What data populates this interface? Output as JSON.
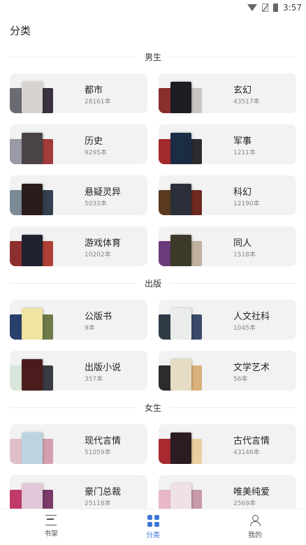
{
  "status_bar": {
    "time": "3:57",
    "icons": [
      "wifi-icon",
      "no-sim-icon",
      "battery-icon"
    ]
  },
  "page": {
    "title": "分类"
  },
  "sections": [
    {
      "label": "男生",
      "items": [
        {
          "name": "都市",
          "count": "28161本",
          "cover_colors": [
            "#6b6b74",
            "#d8d3ce",
            "#3a3240"
          ]
        },
        {
          "name": "玄幻",
          "count": "43517本",
          "cover_colors": [
            "#8a2e2e",
            "#1f1b22",
            "#c9c4c2"
          ]
        },
        {
          "name": "历史",
          "count": "9295本",
          "cover_colors": [
            "#9a9aa4",
            "#4a4448",
            "#a23b3b"
          ]
        },
        {
          "name": "军事",
          "count": "1211本",
          "cover_colors": [
            "#a32a2a",
            "#1b2c45",
            "#2c2b30"
          ]
        },
        {
          "name": "悬疑灵异",
          "count": "5033本",
          "cover_colors": [
            "#7c8a96",
            "#2a1c1c",
            "#344050"
          ]
        },
        {
          "name": "科幻",
          "count": "12190本",
          "cover_colors": [
            "#5a3a20",
            "#2b2f3a",
            "#6e2a20"
          ]
        },
        {
          "name": "游戏体育",
          "count": "10202本",
          "cover_colors": [
            "#8c2e2e",
            "#1e2230",
            "#b04036"
          ]
        },
        {
          "name": "同人",
          "count": "1518本",
          "cover_colors": [
            "#6a3a7a",
            "#3d3a2a",
            "#c0b0a0"
          ]
        }
      ]
    },
    {
      "label": "出版",
      "items": [
        {
          "name": "公版书",
          "count": "9本",
          "cover_colors": [
            "#2a3f6a",
            "#efe4a0",
            "#6f7a4a"
          ]
        },
        {
          "name": "人文社科",
          "count": "1045本",
          "cover_colors": [
            "#2f3c48",
            "#e9ecea",
            "#3b4a6a"
          ]
        },
        {
          "name": "出版小说",
          "count": "357本",
          "cover_colors": [
            "#d9e6d9",
            "#4a1c1c",
            "#3a3c44"
          ]
        },
        {
          "name": "文学艺术",
          "count": "56本",
          "cover_colors": [
            "#2c2c2c",
            "#e6dcc4",
            "#d9b07a"
          ]
        }
      ]
    },
    {
      "label": "女生",
      "items": [
        {
          "name": "现代言情",
          "count": "51059本",
          "cover_colors": [
            "#e0c0c8",
            "#bcd4e0",
            "#d4a0b0"
          ]
        },
        {
          "name": "古代言情",
          "count": "43146本",
          "cover_colors": [
            "#a82a30",
            "#2a1c20",
            "#e8d0a0"
          ]
        },
        {
          "name": "豪门总裁",
          "count": "25118本",
          "cover_colors": [
            "#c03a6a",
            "#e0c8d8",
            "#7a3a6a"
          ]
        },
        {
          "name": "唯美纯爱",
          "count": "2569本",
          "cover_colors": [
            "#e8b8c8",
            "#f0e0e8",
            "#c89aa8"
          ]
        }
      ]
    }
  ],
  "tab_bar": {
    "tabs": [
      {
        "label": "书架",
        "icon": "bookshelf-icon",
        "active": false
      },
      {
        "label": "分类",
        "icon": "category-grid-icon",
        "active": true
      },
      {
        "label": "我的",
        "icon": "user-icon",
        "active": false
      }
    ],
    "active_color": "#3b77d6"
  }
}
